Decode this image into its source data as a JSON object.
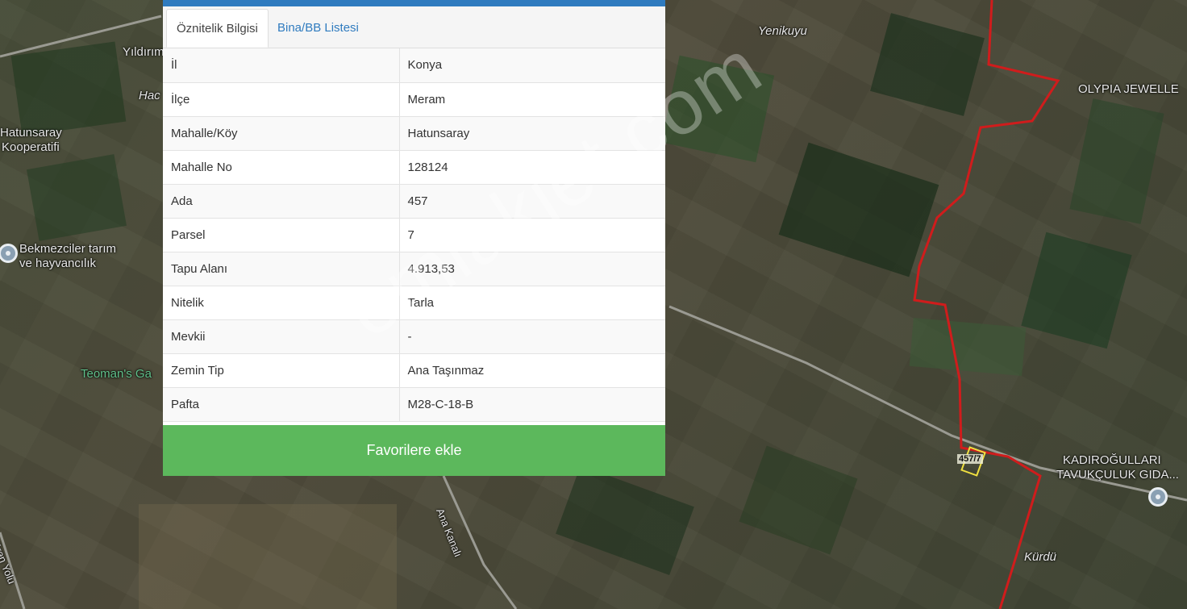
{
  "tabs": [
    {
      "label": "Öznitelik Bilgisi",
      "active": true
    },
    {
      "label": "Bina/BB Listesi",
      "active": false
    }
  ],
  "attributes": [
    {
      "key": "İl",
      "value": "Konya"
    },
    {
      "key": "İlçe",
      "value": "Meram"
    },
    {
      "key": "Mahalle/Köy",
      "value": "Hatunsaray"
    },
    {
      "key": "Mahalle No",
      "value": "128124"
    },
    {
      "key": "Ada",
      "value": "457"
    },
    {
      "key": "Parsel",
      "value": "7"
    },
    {
      "key": "Tapu Alanı",
      "value": "4.913,53"
    },
    {
      "key": "Nitelik",
      "value": "Tarla"
    },
    {
      "key": "Mevkii",
      "value": "-"
    },
    {
      "key": "Zemin Tip",
      "value": "Ana Taşınmaz"
    },
    {
      "key": "Pafta",
      "value": "M28-C-18-B"
    }
  ],
  "favorite_button": "Favorilere ekle",
  "map": {
    "labels": {
      "yildirim": "Yıldırım",
      "hac": "Hac",
      "hatunsaray_1": "Hatunsaray",
      "hatunsaray_2": "Kooperatifi",
      "bekmezciler_1": "Bekmezciler tarım",
      "bekmezciler_2": "ve hayvancılık",
      "teomans": "Teoman's Ga",
      "yenikuyu": "Yenikuyu",
      "olypia": "OLYPIA JEWELLE",
      "kadiroglu_1": "KADIROĞULLARI",
      "kadiroglu_2": "TAVUKÇULUK GIDA...",
      "kurdu": "Kürdü",
      "road_1": "Ana Kanalı",
      "road_2": "ören Yolu"
    },
    "parcel_label": "457/7",
    "boundary_color": "#d01c1c",
    "parcel_color": "#f0e040"
  },
  "watermark": "emlakjet.com",
  "colors": {
    "accent": "#2f7bbf",
    "button": "#5cb85c"
  }
}
